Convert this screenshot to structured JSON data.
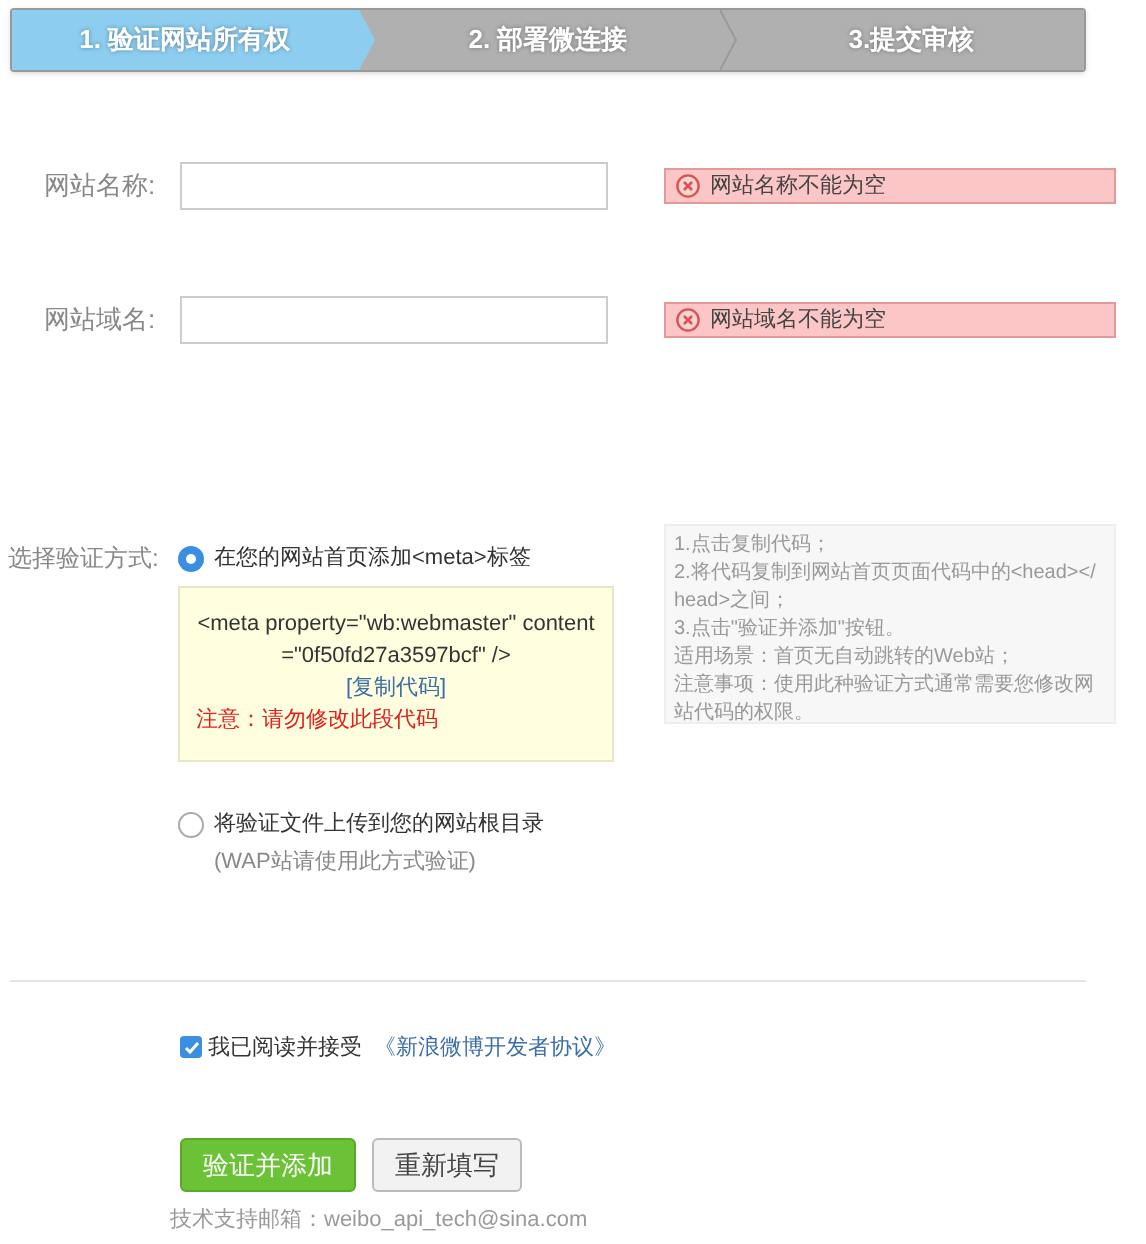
{
  "steps": [
    {
      "label": "1. 验证网站所有权",
      "selected": true
    },
    {
      "label": "2. 部署微连接",
      "selected": false
    },
    {
      "label": "3.提交审核",
      "selected": false
    }
  ],
  "fields": [
    {
      "label": "网站名称:",
      "error": "网站名称不能为空"
    },
    {
      "label": "网站域名:",
      "error": "网站域名不能为空"
    }
  ],
  "verify": {
    "label": "选择验证方式:",
    "options": [
      {
        "label": "在您的网站首页添加<meta>标签",
        "selected": true,
        "code": "<meta property=\"wb:webmaster\" content=\"0f50fd27a3597bcf\" />",
        "copy_link": "[复制代码]",
        "warning": "注意：请勿修改此段代码"
      },
      {
        "label": "将验证文件上传到您的网站根目录",
        "selected": false,
        "note": "(WAP站请使用此方式验证)"
      }
    ],
    "help": [
      "1.点击复制代码；",
      "2.将代码复制到网站首页页面代码中的<head></head>之间；",
      "3.点击\"验证并添加\"按钮。",
      "适用场景：首页无自动跳转的Web站；",
      "注意事项：使用此种验证方式通常需要您修改网站代码的权限。"
    ]
  },
  "agreement": {
    "checked": true,
    "text": "我已阅读并接受",
    "link": "《新浪微博开发者协议》"
  },
  "buttons": [
    {
      "kind": "primary",
      "label": "验证并添加"
    },
    {
      "kind": "secondary",
      "label": "重新填写"
    }
  ],
  "footer": "技术支持邮箱：weibo_api_tech@sina.com"
}
